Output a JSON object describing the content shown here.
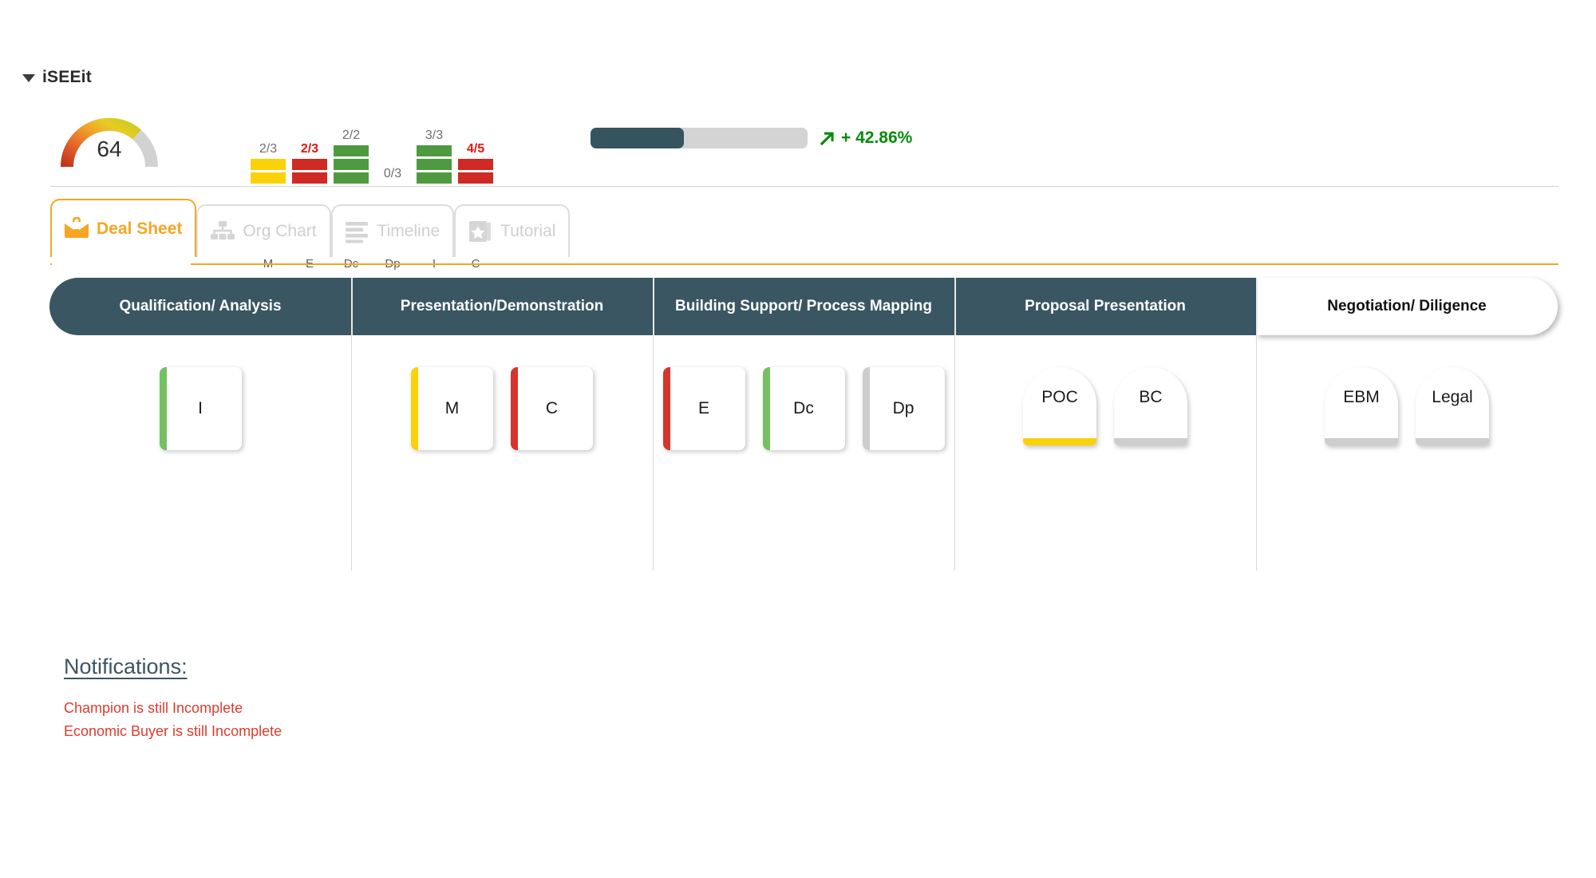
{
  "app": {
    "title": "iSEEit",
    "collapse_icon": "caret-down-icon"
  },
  "summary": {
    "gauge": {
      "value": "64",
      "max": 100,
      "label_icon": "gauge-icon"
    },
    "progress": {
      "percent_fill": 43,
      "delta_label": "+ 42.86%",
      "trend_icon": "arrow-up-right-icon",
      "fill_color": "#36545f",
      "track_color": "#d4d4d4",
      "delta_color": "#068b0a"
    },
    "meddic": {
      "columns": [
        {
          "key": "M",
          "label": "M",
          "score": "2/3",
          "score_state": "ok",
          "filled": 2,
          "color": "#fbd109",
          "seg_class": "y"
        },
        {
          "key": "E",
          "label": "E",
          "score": "2/3",
          "score_state": "bad",
          "filled": 2,
          "color": "#cf2a23",
          "seg_class": "r"
        },
        {
          "key": "Dc",
          "label": "Dc",
          "score": "2/2",
          "score_state": "ok",
          "filled": 3,
          "color": "#4f9a41",
          "seg_class": "g"
        },
        {
          "key": "Dp",
          "label": "Dp",
          "score": "0/3",
          "score_state": "ok",
          "filled": 0,
          "color": "#cdcdcd",
          "seg_class": "e"
        },
        {
          "key": "I",
          "label": "I",
          "score": "3/3",
          "score_state": "ok",
          "filled": 3,
          "color": "#4f9a41",
          "seg_class": "g"
        },
        {
          "key": "C",
          "label": "C",
          "score": "4/5",
          "score_state": "bad",
          "filled": 2,
          "color": "#cf2a23",
          "seg_class": "r"
        }
      ]
    }
  },
  "tabs": [
    {
      "id": "deal-sheet",
      "label": "Deal Sheet",
      "icon": "briefcase-icon",
      "active": true
    },
    {
      "id": "org-chart",
      "label": "Org Chart",
      "icon": "org-chart-icon",
      "active": false
    },
    {
      "id": "timeline",
      "label": "Timeline",
      "icon": "timeline-icon",
      "active": false
    },
    {
      "id": "tutorial",
      "label": "Tutorial",
      "icon": "book-star-icon",
      "active": false
    }
  ],
  "board": {
    "stages": [
      {
        "id": "qualification-analysis",
        "label": "Qualification/ Analysis",
        "state": "past"
      },
      {
        "id": "presentation-demonstration",
        "label": "Presentation/Demonstration",
        "state": "past"
      },
      {
        "id": "building-support-process-mapping",
        "label": "Building Support/ Process Mapping",
        "state": "past"
      },
      {
        "id": "proposal-presentation",
        "label": "Proposal Presentation",
        "state": "past"
      },
      {
        "id": "negotiation-diligence",
        "label": "Negotiation/ Diligence",
        "state": "current"
      }
    ],
    "columns": [
      {
        "stage": "qualification-analysis",
        "cards": [
          {
            "label": "I",
            "shape": "square",
            "status": "green"
          }
        ]
      },
      {
        "stage": "presentation-demonstration",
        "cards": [
          {
            "label": "M",
            "shape": "square",
            "status": "yellow"
          },
          {
            "label": "C",
            "shape": "square",
            "status": "red"
          }
        ]
      },
      {
        "stage": "building-support-process-mapping",
        "cards": [
          {
            "label": "E",
            "shape": "square",
            "status": "red"
          },
          {
            "label": "Dc",
            "shape": "square",
            "status": "green"
          },
          {
            "label": "Dp",
            "shape": "square",
            "status": "grey"
          }
        ]
      },
      {
        "stage": "proposal-presentation",
        "cards": [
          {
            "label": "POC",
            "shape": "arch",
            "status": "yellow"
          },
          {
            "label": "BC",
            "shape": "arch",
            "status": "grey"
          }
        ]
      },
      {
        "stage": "negotiation-diligence",
        "cards": [
          {
            "label": "EBM",
            "shape": "arch",
            "status": "grey"
          },
          {
            "label": "Legal",
            "shape": "arch",
            "status": "grey"
          }
        ]
      }
    ]
  },
  "notifications": {
    "title": "Notifications:",
    "items": [
      "Champion is still Incomplete",
      "Economic Buyer is still Incomplete"
    ]
  },
  "colors": {
    "green": "#74c063",
    "yellow": "#fbd109",
    "red": "#d6352b",
    "grey": "#cdcdcd",
    "stage_bg": "#3a5662",
    "accent_orange": "#f6a623",
    "notif_red": "#df3b2e",
    "notif_title": "#3b5563"
  }
}
